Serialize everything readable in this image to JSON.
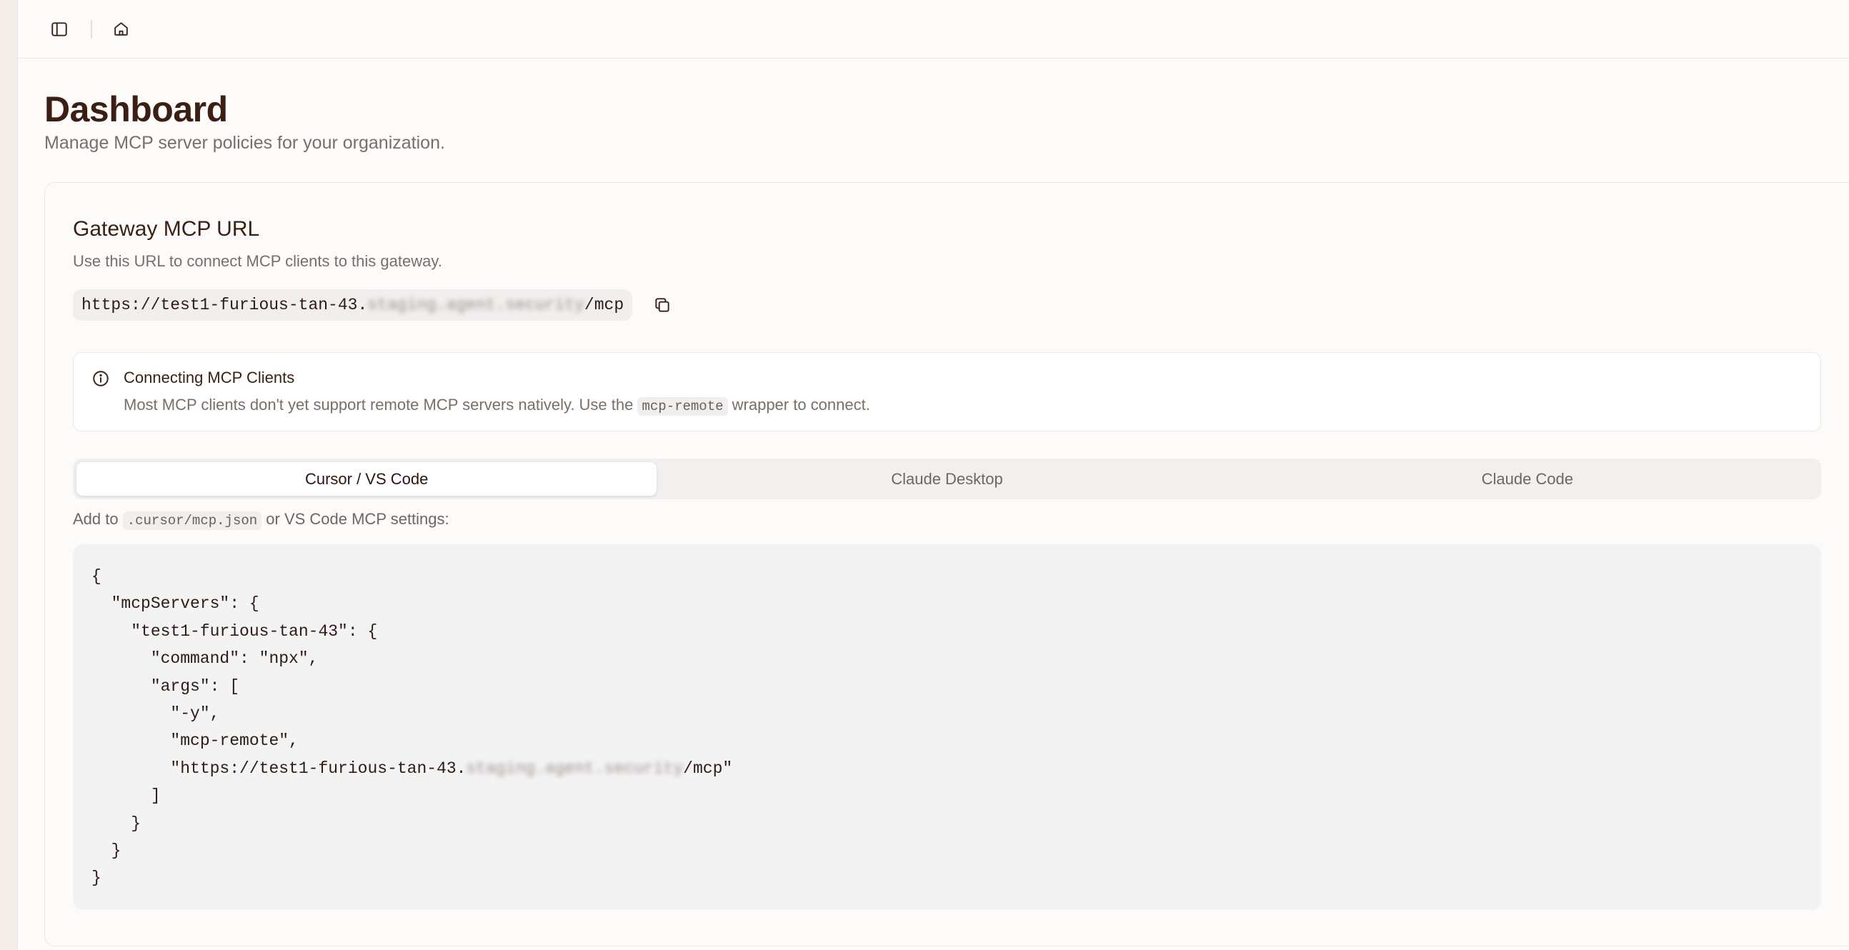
{
  "topbar": {
    "sidebar_toggle_icon": "sidebar-toggle-icon",
    "home_icon": "home-icon"
  },
  "page": {
    "title": "Dashboard",
    "subtitle": "Manage MCP server policies for your organization."
  },
  "gateway": {
    "title": "Gateway MCP URL",
    "description": "Use this URL to connect MCP clients to this gateway.",
    "url_prefix": "https://test1-furious-tan-43.",
    "url_redacted": "staging.agent.security",
    "url_suffix": "/mcp",
    "copy_icon": "copy-icon"
  },
  "alert": {
    "icon": "info-icon",
    "title": "Connecting MCP Clients",
    "body_before": "Most MCP clients don't yet support remote MCP servers natively. Use the ",
    "body_code": "mcp-remote",
    "body_after": " wrapper to connect."
  },
  "tabs": [
    {
      "label": "Cursor / VS Code",
      "active": true
    },
    {
      "label": "Claude Desktop",
      "active": false
    },
    {
      "label": "Claude Code",
      "active": false
    }
  ],
  "hint": {
    "before": "Add to ",
    "code": ".cursor/mcp.json",
    "after": " or VS Code MCP settings:"
  },
  "code": {
    "lines": [
      "{",
      "  \"mcpServers\": {",
      "    \"test1-furious-tan-43\": {",
      "      \"command\": \"npx\",",
      "      \"args\": [",
      "        \"-y\",",
      "        \"mcp-remote\",",
      "        \"https://test1-furious-tan-43.",
      "      ]",
      "    }",
      "  }",
      "}"
    ],
    "url_line_redacted": "staging.agent.security",
    "url_line_suffix": "/mcp\""
  }
}
